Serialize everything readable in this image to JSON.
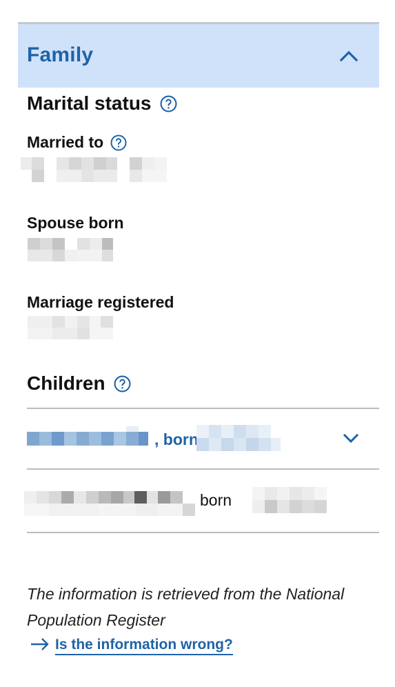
{
  "accordion": {
    "title": "Family",
    "expanded_icon": "chevron-up-icon"
  },
  "marital_status": {
    "heading": "Marital status",
    "married_to_label": "Married to",
    "spouse_born_label": "Spouse born",
    "marriage_registered_label": "Marriage registered"
  },
  "children": {
    "heading": "Children",
    "rows": [
      {
        "born_label": ", born",
        "expand_icon": "chevron-down-icon"
      },
      {
        "born_label": "born"
      }
    ]
  },
  "footer": {
    "source_note": "The information is retrieved from the National Population Register",
    "wrong_link_label": "Is the information wrong?",
    "wrong_link_icon": "arrow-right-icon"
  },
  "colors": {
    "accent": "#1e63a8",
    "header_bg": "#cfe2f9",
    "rule": "#b8bcc1"
  }
}
